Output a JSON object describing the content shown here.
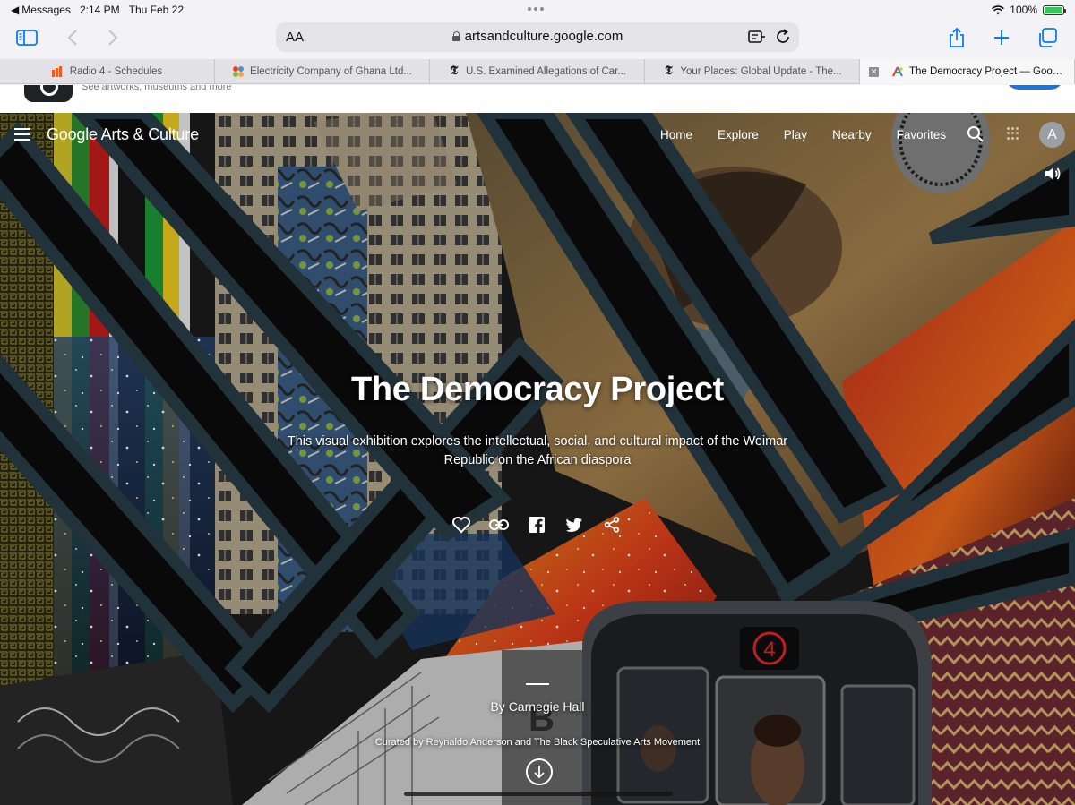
{
  "status_bar": {
    "back_app": "Messages",
    "time": "2:14 PM",
    "date": "Thu Feb 22",
    "battery": "100%"
  },
  "address_bar": {
    "reader_label": "AA",
    "url": "artsandculture.google.com"
  },
  "tabs": [
    {
      "title": "Radio 4 - Schedules",
      "favicon": "bbc-sounds-icon",
      "color": "#f55a1c"
    },
    {
      "title": "Electricity Company of Ghana Ltd...",
      "favicon": "joomla-icon",
      "color": "#f9a541"
    },
    {
      "title": "U.S. Examined Allegations of Car...",
      "favicon": "nyt-icon",
      "color": "#222222"
    },
    {
      "title": "Your Places: Global Update - The...",
      "favicon": "nyt-icon",
      "color": "#222222"
    },
    {
      "title": "The Democracy Project — Google...",
      "favicon": "google-arts-icon",
      "color": "#4285f4",
      "active": true
    }
  ],
  "page_peek": {
    "subtitle": "See artworks, museums and more"
  },
  "site_nav": {
    "brand": "Google Arts & Culture",
    "links": [
      "Home",
      "Explore",
      "Play",
      "Nearby",
      "Favorites"
    ],
    "avatar_initial": "A"
  },
  "hero": {
    "title": "The Democracy Project",
    "description": "This visual exhibition explores the intellectual, social, and cultural impact of the Weimar Republic on the African diaspora",
    "by": "By Carnegie Hall",
    "curated": "Curated by Reynaldo Anderson and The Black Speculative Arts Movement",
    "train_number": "4"
  },
  "colors": {
    "accent": "#0a7aff",
    "google_blue": "#1a73e8",
    "hero_text": "#ffffff"
  }
}
